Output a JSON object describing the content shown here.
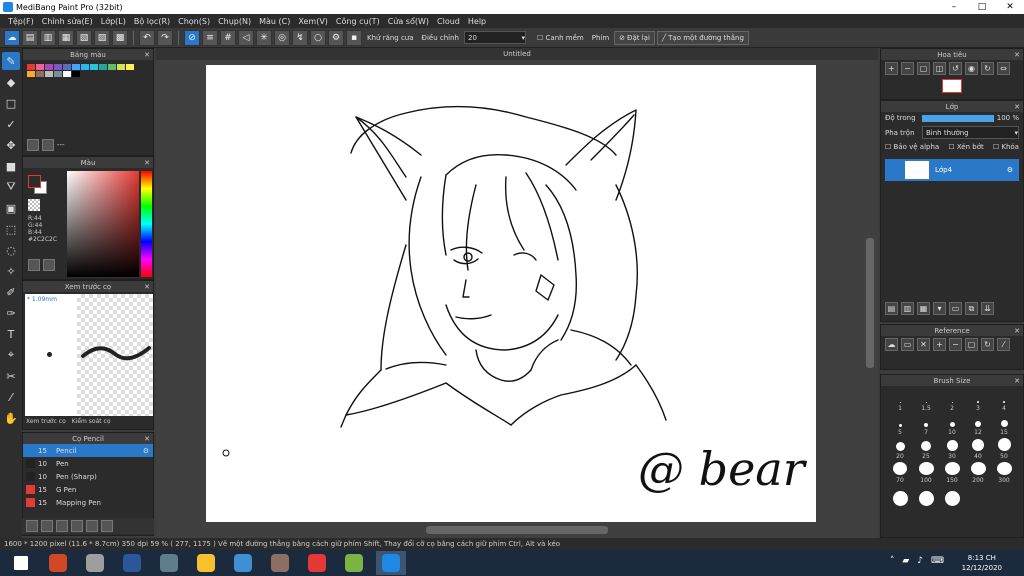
{
  "window": {
    "title": "MediBang Paint Pro (32bit)",
    "min": "–",
    "max": "□",
    "close": "✕"
  },
  "menu": [
    "Tệp(F)",
    "Chỉnh sửa(E)",
    "Lớp(L)",
    "Bộ lọc(R)",
    "Chọn(S)",
    "Chụp(N)",
    "Màu (C)",
    "Xem(V)",
    "Công cụ(T)",
    "Cửa sổ(W)",
    "Cloud",
    "Help"
  ],
  "toolbar": {
    "antialias": "Khử răng cưa",
    "adjust_label": "Điều chỉnh",
    "adjust_value": "20",
    "smoothing": "Canh mềm",
    "key_label": "Phím",
    "reset": "Đặt lại",
    "create_line": "Tạo một đường thẳng"
  },
  "palette": {
    "title": "Bảng màu",
    "colors": [
      "#e53935",
      "#f06292",
      "#ab47bc",
      "#7e57c2",
      "#5c6bc0",
      "#42a5f5",
      "#29b6f6",
      "#26c6da",
      "#26a69a",
      "#66bb6a",
      "#d4e157",
      "#ffee58",
      "#ffa726",
      "#8d6e63",
      "#bdbdbd",
      "#78909c",
      "#ffffff",
      "#000000"
    ],
    "footer": "---"
  },
  "color": {
    "title": "Màu",
    "r": "R:44",
    "g": "G:44",
    "b": "B:44",
    "hex": "#2C2C2C"
  },
  "preview": {
    "title": "Xem trước cọ",
    "size": "1.09mm",
    "tab1": "Xem trước cọ",
    "tab2": "Kiểm soát cọ"
  },
  "brush": {
    "title": "Cọ Pencil",
    "items": [
      {
        "size": "15",
        "name": "Pencil",
        "color": "#2a78c8",
        "selected": true
      },
      {
        "size": "10",
        "name": "Pen",
        "color": "#222"
      },
      {
        "size": "10",
        "name": "Pen (Sharp)",
        "color": "#222"
      },
      {
        "size": "15",
        "name": "G Pen",
        "color": "#e53935"
      },
      {
        "size": "15",
        "name": "Mapping Pen",
        "color": "#e53935"
      }
    ]
  },
  "document": {
    "tab": "Untitled",
    "signature": "@ bear"
  },
  "navigator": {
    "title": "Hoa tiêu"
  },
  "layer": {
    "title": "Lớp",
    "opacity_label": "Độ trong",
    "opacity_value": "100 %",
    "opacity_fraction": 1.0,
    "blend_label": "Pha trộn",
    "blend_value": "Bình thường",
    "protect_alpha": "Bảo vệ alpha",
    "clipping": "Xén bớt",
    "lock": "Khóa",
    "layer_name": "Lớp4"
  },
  "reference": {
    "title": "Reference"
  },
  "brushsize": {
    "title": "Brush Size",
    "sizes": [
      {
        "v": "1",
        "d": 1
      },
      {
        "v": "1.5",
        "d": 1
      },
      {
        "v": "2",
        "d": 1
      },
      {
        "v": "3",
        "d": 2
      },
      {
        "v": "4",
        "d": 2
      },
      {
        "v": "5",
        "d": 3
      },
      {
        "v": "7",
        "d": 4
      },
      {
        "v": "10",
        "d": 5
      },
      {
        "v": "12",
        "d": 6
      },
      {
        "v": "15",
        "d": 7
      },
      {
        "v": "20",
        "d": 9
      },
      {
        "v": "25",
        "d": 10
      },
      {
        "v": "30",
        "d": 11
      },
      {
        "v": "40",
        "d": 12
      },
      {
        "v": "50",
        "d": 13
      },
      {
        "v": "70",
        "d": 14
      },
      {
        "v": "100",
        "d": 15
      },
      {
        "v": "150",
        "d": 15
      },
      {
        "v": "200",
        "d": 15
      },
      {
        "v": "300",
        "d": 15
      },
      {
        "v": "",
        "d": 15
      },
      {
        "v": "",
        "d": 15
      },
      {
        "v": "",
        "d": 15
      }
    ]
  },
  "status": "1600 * 1200 pixel  (11.6 * 8.7cm)  350 dpi  59 %  ( 277, 1175 )  Vẽ một đường thẳng bằng cách giữ phím Shift, Thay đổi cỡ cọ bằng cách giữ phím Ctrl, Alt và kéo",
  "taskbar": {
    "time": "8:13 CH",
    "date": "12/12/2020",
    "apps": [
      {
        "name": "start",
        "color": "#ffffff"
      },
      {
        "name": "powerpoint",
        "color": "#d24726"
      },
      {
        "name": "app",
        "color": "#9e9e9e"
      },
      {
        "name": "word",
        "color": "#2b579a"
      },
      {
        "name": "calculator",
        "color": "#607d8b"
      },
      {
        "name": "chrome",
        "color": "#fbc02d"
      },
      {
        "name": "explorer",
        "color": "#3f8fd2"
      },
      {
        "name": "app",
        "color": "#8d6e63"
      },
      {
        "name": "snipping",
        "color": "#e53935"
      },
      {
        "name": "app",
        "color": "#7cb342"
      },
      {
        "name": "medibang",
        "color": "#1e88e5"
      }
    ]
  }
}
